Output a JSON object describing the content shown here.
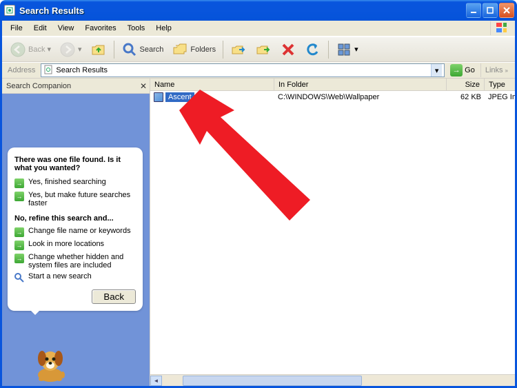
{
  "window": {
    "title": "Search Results"
  },
  "menus": [
    "File",
    "Edit",
    "View",
    "Favorites",
    "Tools",
    "Help"
  ],
  "toolbar": {
    "back": "Back",
    "search": "Search",
    "folders": "Folders"
  },
  "address": {
    "label": "Address",
    "value": "Search Results",
    "go": "Go",
    "links": "Links"
  },
  "companion": {
    "title": "Search Companion",
    "balloon_header": "There was one file found.  Is it what you wanted?",
    "opt_finished": "Yes, finished searching",
    "opt_faster": "Yes, but make future searches faster",
    "refine_header": "No, refine this search and...",
    "opt_name": "Change file name or keywords",
    "opt_locations": "Look in more locations",
    "opt_hidden": "Change whether hidden and system files are included",
    "opt_new": "Start a new search",
    "back": "Back"
  },
  "columns": {
    "name": "Name",
    "folder": "In Folder",
    "size": "Size",
    "type": "Type"
  },
  "results": [
    {
      "name": "Ascent",
      "folder": "C:\\WINDOWS\\Web\\Wallpaper",
      "size": "62 KB",
      "type": "JPEG Image",
      "selected": true
    }
  ]
}
